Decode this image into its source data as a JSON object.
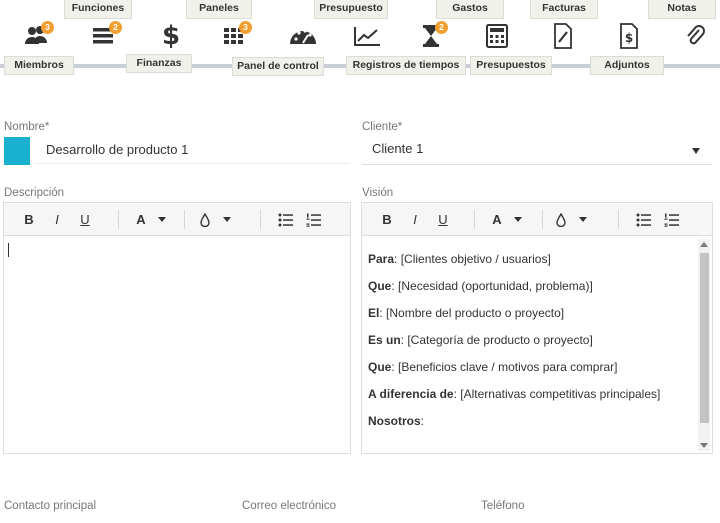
{
  "nav": {
    "top_tabs": [
      "Funciones",
      "Paneles",
      "Presupuesto",
      "Gastos",
      "Facturas",
      "Notas"
    ],
    "bottom_tabs": [
      "Miembros",
      "Finanzas",
      "Panel de control",
      "Registros de tiempos",
      "Presupuestos",
      "Adjuntos"
    ],
    "icons": [
      {
        "name": "members-icon",
        "badge": "3"
      },
      {
        "name": "list-icon",
        "badge": "2"
      },
      {
        "name": "dollar-icon",
        "glyph": "$"
      },
      {
        "name": "grid-icon",
        "badge": "3"
      },
      {
        "name": "dashboard-gauge-icon"
      },
      {
        "name": "line-chart-icon"
      },
      {
        "name": "hourglass-icon",
        "badge": "2"
      },
      {
        "name": "calculator-icon"
      },
      {
        "name": "document-edit-icon"
      },
      {
        "name": "invoice-dollar-icon",
        "glyph": "$"
      },
      {
        "name": "paperclip-icon"
      }
    ],
    "badge_color": "#f0a030",
    "line_color": "#c9ced6"
  },
  "form": {
    "name_label": "Nombre*",
    "name_value": "Desarrollo de producto 1",
    "swatch_color": "#1ab0d0",
    "client_label": "Cliente*",
    "client_value": "Cliente 1",
    "description_label": "Descripción",
    "vision_label": "Visión",
    "contact_label": "Contacto principal",
    "email_label": "Correo electrónico",
    "phone_label": "Teléfono"
  },
  "editor_toolbar": {
    "bold": "B",
    "italic": "I",
    "underline": "U",
    "font_color": "A"
  },
  "vision": {
    "lines": [
      {
        "key": "Para",
        "value": " [Clientes objetivo / usuarios]"
      },
      {
        "key": "Que",
        "value": " [Necesidad (oportunidad, problema)]"
      },
      {
        "key": "El",
        "value": " [Nombre del producto o proyecto]"
      },
      {
        "key": "Es un",
        "value": " [Categoría de producto o proyecto]"
      },
      {
        "key": "Que",
        "value": " [Beneficios clave / motivos para comprar]"
      },
      {
        "key": "A diferencia de",
        "value": " [Alternativas competitivas principales]"
      },
      {
        "key": "Nosotros",
        "value": ""
      }
    ]
  }
}
